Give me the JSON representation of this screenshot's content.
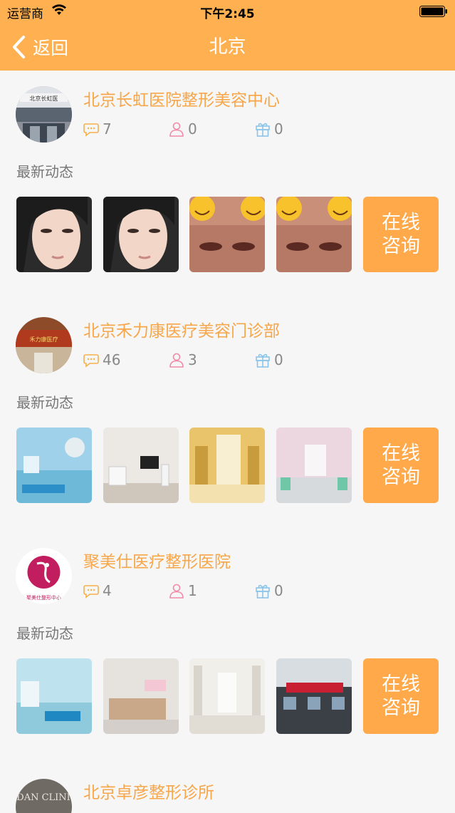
{
  "status_bar": {
    "carrier": "运营商",
    "time": "下午2:45"
  },
  "nav": {
    "back_label": "返回",
    "title": "北京"
  },
  "latest_label": "最新动态",
  "consult_line1": "在线",
  "consult_line2": "咨询",
  "hospitals": [
    {
      "name": "北京长虹医院整形美容中心",
      "consults": "7",
      "users": "0",
      "gifts": "0",
      "logo_text": "北京长虹医"
    },
    {
      "name": "北京禾力康医疗美容门诊部",
      "consults": "46",
      "users": "3",
      "gifts": "0",
      "logo_text": "禾力康医疗"
    },
    {
      "name": "聚美仕医疗整形医院",
      "consults": "4",
      "users": "1",
      "gifts": "0",
      "logo_text": "聚美仕整形中心"
    },
    {
      "name": "北京卓彦整形诊所",
      "logo_text": "ZDAN CLINIC"
    }
  ],
  "colors": {
    "header": "#ffb051",
    "accent": "#f7a64a",
    "button": "#ffa94b"
  }
}
